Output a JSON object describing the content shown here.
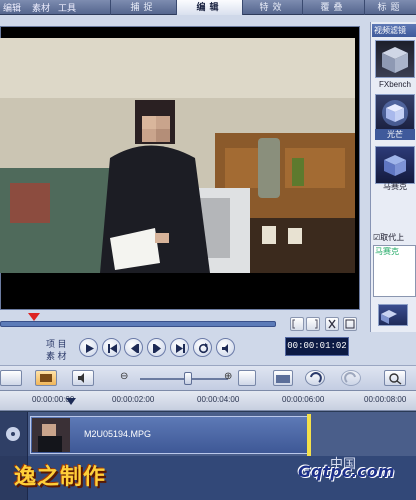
{
  "menu": {
    "items": [
      "编辑",
      "素材",
      "工具"
    ]
  },
  "steps": [
    {
      "label": "捕捉",
      "active": false
    },
    {
      "label": "编辑",
      "active": true
    },
    {
      "label": "特效",
      "active": false
    },
    {
      "label": "覆叠",
      "active": false
    },
    {
      "label": "标题",
      "active": false
    }
  ],
  "player": {
    "mode_top": "项 目",
    "mode_bottom": "素 材",
    "timecode": "00:00:01:02"
  },
  "sidebar": {
    "title": "视频滤镜",
    "filters": [
      {
        "name": "FXbench"
      },
      {
        "name": "光芒"
      },
      {
        "name": "马赛克"
      }
    ],
    "replace_label": "☑取代上",
    "applied": [
      "马赛克"
    ]
  },
  "timeline": {
    "ticks": [
      "00:00:00:00",
      "00:00:02:00",
      "00:00:04:00",
      "00:00:06:00",
      "00:00:08:00"
    ],
    "clip_name": "M2U05194.MPG"
  },
  "overlay": {
    "watermark": "逸之制作",
    "site_top": "中国",
    "site_logo": "Gqtpc.com"
  }
}
